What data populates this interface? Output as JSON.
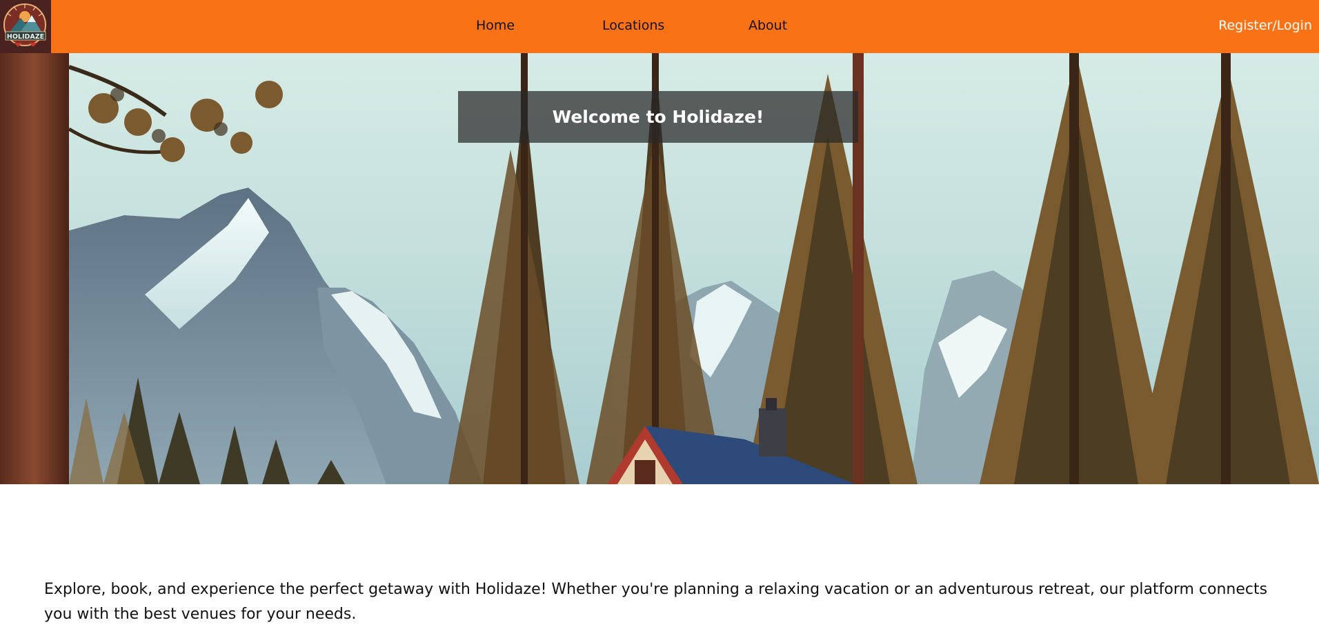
{
  "brand": {
    "logo_text": "HOLIDAZE",
    "colors": {
      "nav_background": "#f97316",
      "welcome_overlay": "#282828"
    }
  },
  "nav": {
    "links": [
      {
        "label": "Home"
      },
      {
        "label": "Locations"
      },
      {
        "label": "About"
      }
    ],
    "auth_label": "Register/Login"
  },
  "hero": {
    "welcome_text": "Welcome to Holidaze!"
  },
  "intro": {
    "text": "Explore, book, and experience the perfect getaway with Holidaze! Whether you're planning a relaxing vacation or an adventurous retreat, our platform connects you with the best venues for your needs."
  }
}
